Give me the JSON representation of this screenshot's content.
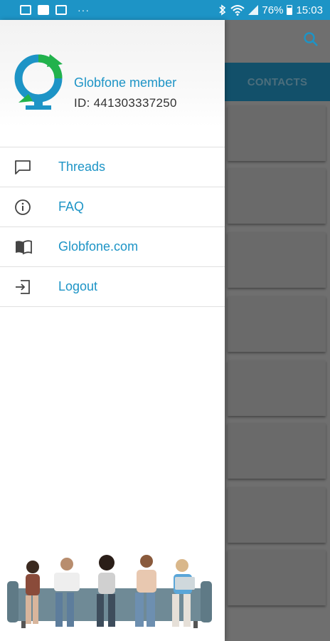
{
  "status_bar": {
    "battery": "76%",
    "time": "15:03",
    "overflow": "···"
  },
  "background_app": {
    "tab_label": "CONTACTS"
  },
  "drawer": {
    "member_title": "Globfone member",
    "id_label": "ID:",
    "id_value": "441303337250",
    "menu": [
      {
        "label": "Threads",
        "icon": "chat-icon"
      },
      {
        "label": "FAQ",
        "icon": "info-icon"
      },
      {
        "label": "Globfone.com",
        "icon": "book-icon"
      },
      {
        "label": "Logout",
        "icon": "logout-icon"
      }
    ]
  },
  "colors": {
    "accent": "#1d94c6",
    "logo_green": "#22b24c",
    "tab_dark": "#12506a"
  }
}
